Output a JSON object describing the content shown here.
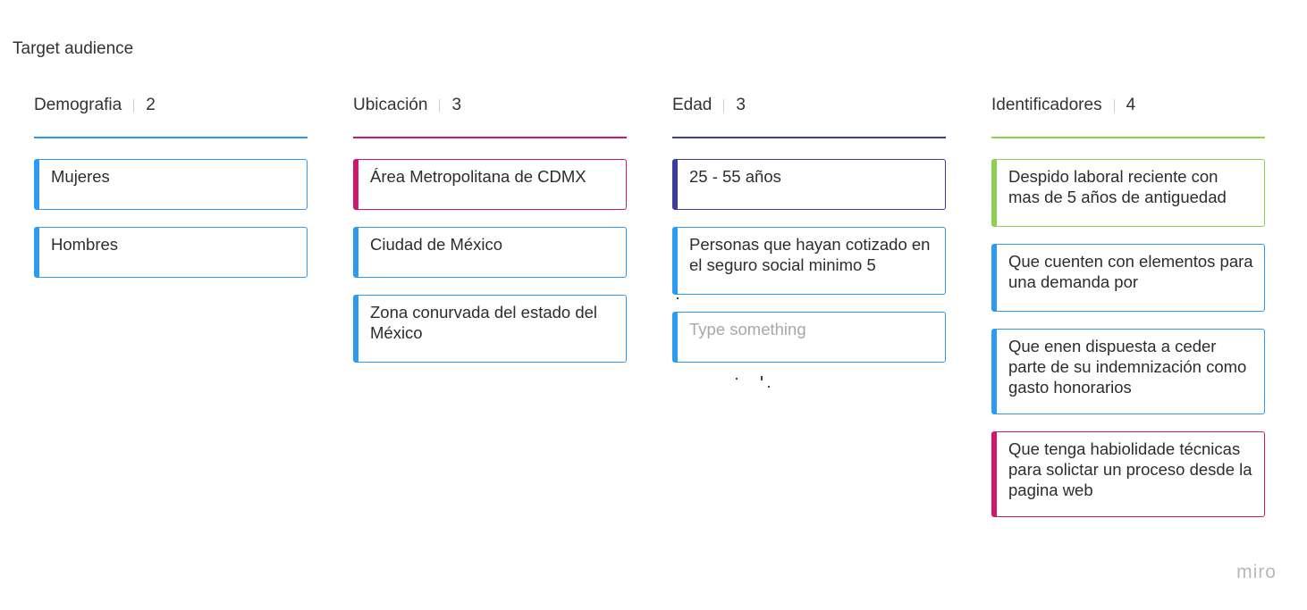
{
  "board": {
    "title": "Target audience",
    "watermark": "miro"
  },
  "colors": {
    "blue": "#2d9bf0",
    "pink": "#d0156a",
    "indigo": "#3c3c9c",
    "green": "#8fd14f"
  },
  "columns": [
    {
      "title": "Demografia",
      "count": "2",
      "line_color": "#2d9bf0",
      "cards": [
        {
          "text": "Mujeres",
          "color": "blue"
        },
        {
          "text": "Hombres",
          "color": "blue"
        }
      ]
    },
    {
      "title": "Ubicación",
      "count": "3",
      "line_color": "#d0156a",
      "cards": [
        {
          "text": "Área Metropolitana de CDMX",
          "color": "pink"
        },
        {
          "text": "Ciudad de México",
          "color": "blue"
        },
        {
          "text": "Zona conurvada del estado del México",
          "color": "blue"
        }
      ]
    },
    {
      "title": "Edad",
      "count": "3",
      "line_color": "#3c3c9c",
      "cards": [
        {
          "text": "25 - 55 años",
          "color": "indigo"
        },
        {
          "text": "Personas que hayan cotizado en el seguro social minimo 5",
          "color": "blue"
        },
        {
          "placeholder": "Type something",
          "color": "blue"
        }
      ]
    },
    {
      "title": "Identificadores",
      "count": "4",
      "line_color": "#8fd14f",
      "cards": [
        {
          "text": "Despido laboral reciente con mas de 5 años de antiguedad",
          "color": "green"
        },
        {
          "text": "Que cuenten con elementos para una demanda por",
          "color": "blue"
        },
        {
          "text": "Que enen dispuesta a ceder parte de su indemnización como gasto honorarios",
          "color": "blue"
        },
        {
          "text": "Que tenga habiolidade técnicas para solictar un proceso desde la pagina web",
          "color": "pink"
        }
      ]
    }
  ]
}
